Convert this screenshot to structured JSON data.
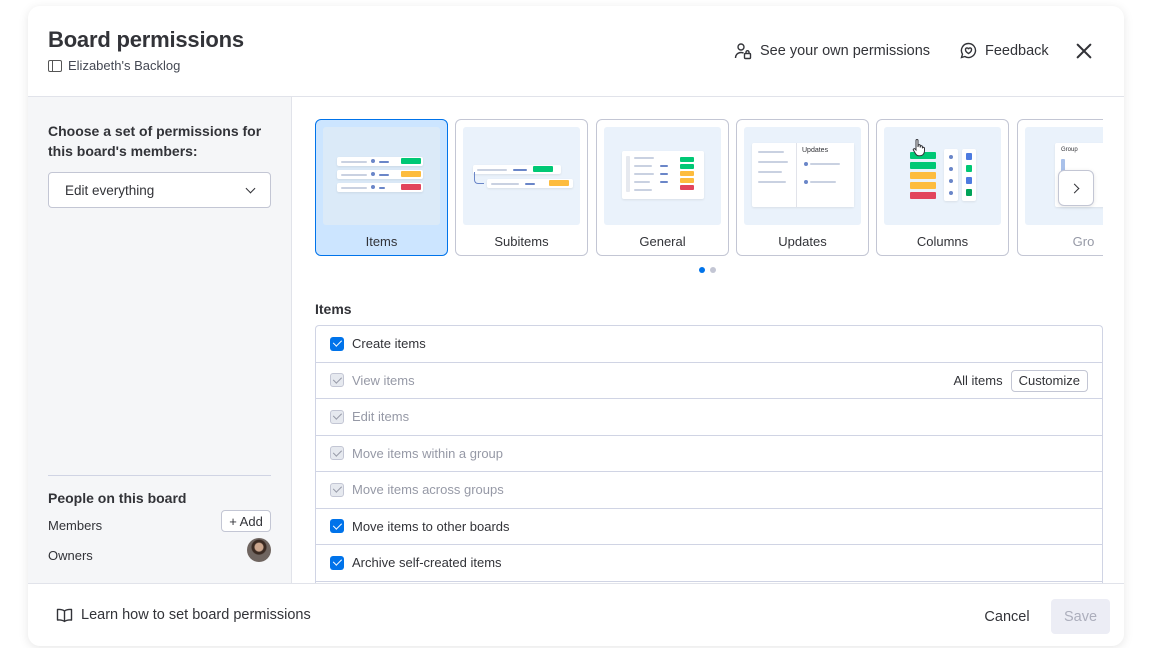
{
  "header": {
    "title": "Board permissions",
    "board_name": "Elizabeth's Backlog",
    "own_permissions_label": "See your own permissions",
    "feedback_label": "Feedback"
  },
  "sidebar": {
    "heading": "Choose a set of permissions for this board's members:",
    "select_value": "Edit everything",
    "people_title": "People on this board",
    "members_label": "Members",
    "add_label": "+ Add",
    "owners_label": "Owners"
  },
  "carousel": {
    "cards": [
      {
        "label": "Items",
        "selected": true
      },
      {
        "label": "Subitems",
        "selected": false
      },
      {
        "label": "General",
        "selected": false
      },
      {
        "label": "Updates",
        "selected": false,
        "thumb_text": "Updates"
      },
      {
        "label": "Columns",
        "selected": false
      },
      {
        "label": "Gro",
        "selected": false,
        "thumb_text": "Group"
      }
    ],
    "pages": 2,
    "active_page": 1
  },
  "section_title": "Items",
  "permissions": [
    {
      "label": "Create items",
      "checked": true,
      "disabled": false
    },
    {
      "label": "View items",
      "checked": true,
      "disabled": true,
      "scope": "All items",
      "action": "Customize"
    },
    {
      "label": "Edit items",
      "checked": true,
      "disabled": true
    },
    {
      "label": "Move items within a group",
      "checked": true,
      "disabled": true
    },
    {
      "label": "Move items across groups",
      "checked": true,
      "disabled": true
    },
    {
      "label": "Move items to other boards",
      "checked": true,
      "disabled": false
    },
    {
      "label": "Archive self-created items",
      "checked": true,
      "disabled": false
    }
  ],
  "footer": {
    "learn_label": "Learn how to set board permissions",
    "cancel_label": "Cancel",
    "save_label": "Save"
  },
  "colors": {
    "accent": "#0073ea",
    "selected_bg": "#cce5ff",
    "green": "#00c875",
    "yellow": "#fdbc3e",
    "red": "#e2445c"
  },
  "icons": [
    "board-icon",
    "person-lock-icon",
    "feedback-icon",
    "close-icon",
    "chevron-down-icon",
    "chevron-right-icon",
    "book-icon",
    "checkbox-icon"
  ]
}
